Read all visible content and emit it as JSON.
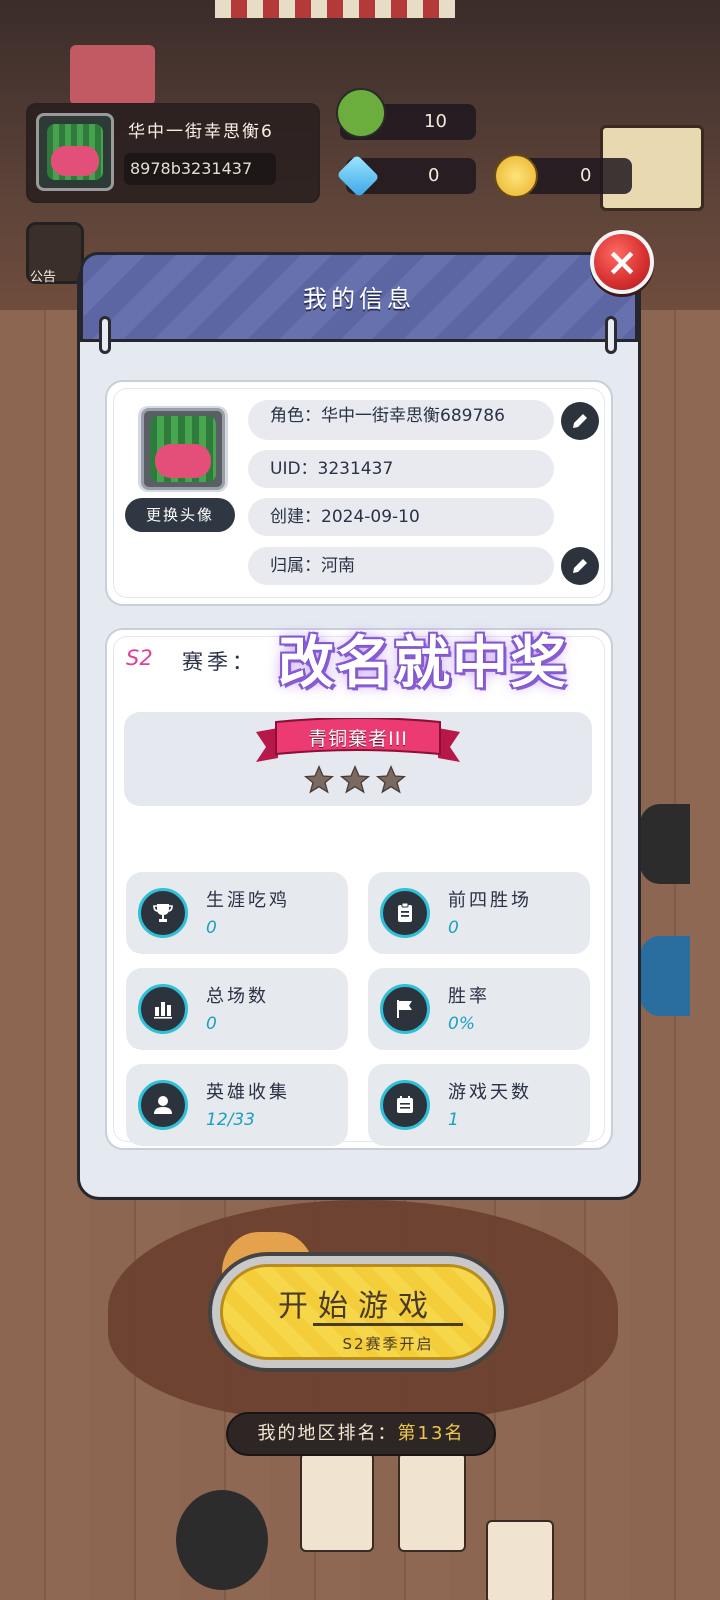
{
  "topbar": {
    "player_name": "华中一街幸思衡6",
    "player_uid": "8978b3231437",
    "resource_1": "10",
    "diamonds": "0",
    "coins": "0",
    "notice_label": "公告"
  },
  "modal": {
    "title": "我的信息",
    "profile": {
      "change_avatar": "更换头像",
      "role": "角色：华中一街幸思衡689786",
      "uid": "UID：3231437",
      "created": "创建：2024-09-10",
      "region": "归属：河南"
    },
    "season": {
      "code": "S2",
      "label": "赛季：",
      "rank_title": "青铜棄者III",
      "stars": 3
    },
    "promo_text": "改名就中奖",
    "stats": [
      {
        "label": "生涯吃鸡",
        "value": "0",
        "icon": "trophy-icon"
      },
      {
        "label": "前四胜场",
        "value": "0",
        "icon": "clipboard-icon"
      },
      {
        "label": "总场数",
        "value": "0",
        "icon": "bar-chart-icon"
      },
      {
        "label": "胜率",
        "value": "0%",
        "icon": "flag-icon"
      },
      {
        "label": "英雄收集",
        "value": "12/33",
        "icon": "person-icon"
      },
      {
        "label": "游戏天数",
        "value": "1",
        "icon": "calendar-icon"
      }
    ]
  },
  "start": {
    "label": "开始游戏",
    "sub": "S2赛季开启"
  },
  "region_rank": {
    "label": "我的地区排名：",
    "value": "第13名"
  },
  "colors": {
    "header": "#5b66a3",
    "close": "#d52f2f",
    "icon_ring": "#2ec0d6",
    "stat_value": "#1aa0c0",
    "season_code": "#e0409c",
    "promo_glow": "#8a5ed6"
  }
}
